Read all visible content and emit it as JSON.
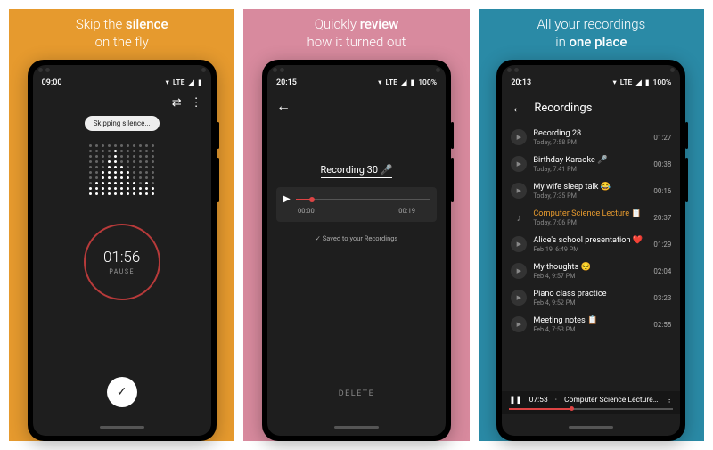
{
  "panels": [
    {
      "bg": "#e69a2e",
      "tag_pre": "Skip the ",
      "tag_bold": "silence",
      "tag_post": "\non the fly"
    },
    {
      "bg": "#d88a9e",
      "tag_pre": "Quickly ",
      "tag_bold": "review",
      "tag_post": "\nhow it turned out"
    },
    {
      "bg": "#2a8aa6",
      "tag_pre": "All your recordings\nin ",
      "tag_bold": "one place",
      "tag_post": ""
    }
  ],
  "phone1": {
    "status_time": "09:00",
    "network": "LTE",
    "battery_icon": "◢▮",
    "pill": "Skipping silence...",
    "viz_heights": [
      2,
      3,
      5,
      7,
      9,
      6,
      5,
      3,
      2,
      3,
      2
    ],
    "timer": "01:56",
    "timer_label": "PAUSE",
    "fab_icon": "✓"
  },
  "phone2": {
    "status_time": "20:15",
    "network": "LTE",
    "battery": "100%",
    "title": "Recording 30 🎤",
    "progress": 0.12,
    "start": "00:00",
    "end": "00:19",
    "saved": "✓ Saved to your Recordings",
    "delete": "DELETE"
  },
  "phone3": {
    "status_time": "20:13",
    "network": "LTE",
    "battery": "100%",
    "header": "Recordings",
    "items": [
      {
        "title": "Recording 28",
        "sub": "Today, 7:58 PM",
        "dur": "01:27",
        "active": false,
        "icon": "play"
      },
      {
        "title": "Birthday Karaoke 🎤",
        "sub": "Today, 7:41 PM",
        "dur": "00:38",
        "active": false,
        "icon": "play"
      },
      {
        "title": "My wife sleep talk 😂",
        "sub": "Today, 7:35 PM",
        "dur": "00:16",
        "active": false,
        "icon": "play"
      },
      {
        "title": "Computer Science Lecture 📋",
        "sub": "Today, 7:06 PM",
        "dur": "20:37",
        "active": true,
        "icon": "note"
      },
      {
        "title": "Alice's school presentation ❤️",
        "sub": "Feb 19, 6:49 PM",
        "dur": "01:29",
        "active": false,
        "icon": "play"
      },
      {
        "title": "My thoughts 😔",
        "sub": "Feb 4, 9:57 PM",
        "dur": "02:04",
        "active": false,
        "icon": "play"
      },
      {
        "title": "Piano class practice",
        "sub": "Feb 4, 9:52 PM",
        "dur": "03:23",
        "active": false,
        "icon": "play"
      },
      {
        "title": "Meeting notes 📋",
        "sub": "Feb 4, 7:53 PM",
        "dur": "02:58",
        "active": false,
        "icon": "play"
      }
    ],
    "np_time": "07:53",
    "np_title": "Computer Science Lecture 📋",
    "np_progress": 0.38
  }
}
